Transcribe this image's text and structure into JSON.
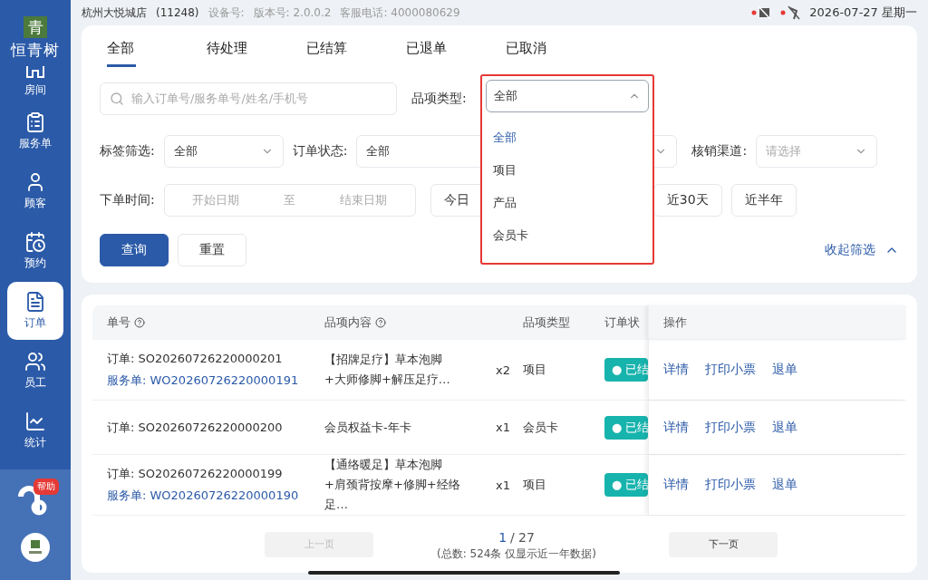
{
  "status_bar": {
    "store": "杭州大悦城店",
    "store_code": "(11248)",
    "device": "设备号:",
    "version": "版本号: 2.0.0.2",
    "hotline": "客服电话: 4000080629",
    "printer_offline": true,
    "scanner_offline": true,
    "datetime": "2026-07-27 星期一"
  },
  "sidebar": {
    "logo_mark": "青",
    "brand": "恒青树",
    "items": [
      {
        "label": "房间",
        "selected": false
      },
      {
        "label": "服务单",
        "selected": false
      },
      {
        "label": "顾客",
        "selected": false
      },
      {
        "label": "预约",
        "selected": false
      },
      {
        "label": "订单",
        "selected": true
      },
      {
        "label": "员工",
        "selected": false
      },
      {
        "label": "统计",
        "selected": false
      }
    ],
    "help_badge": "帮助"
  },
  "tabs": [
    {
      "label": "全部",
      "selected": true
    },
    {
      "label": "待处理",
      "selected": false
    },
    {
      "label": "已结算",
      "selected": false
    },
    {
      "label": "已退单",
      "selected": false
    },
    {
      "label": "已取消",
      "selected": false
    }
  ],
  "filters": {
    "search": {
      "placeholder": "输入订单号/服务单号/姓名/手机号"
    },
    "item_type": {
      "label": "品项类型:",
      "value": "全部",
      "expanded": true,
      "options": [
        {
          "label": "全部",
          "selected": true
        },
        {
          "label": "项目",
          "selected": false
        },
        {
          "label": "产品",
          "selected": false
        },
        {
          "label": "会员卡",
          "selected": false
        }
      ]
    },
    "tag": {
      "label": "标签筛选:",
      "value": "全部"
    },
    "order_status": {
      "label": "订单状态:",
      "value": "全部"
    },
    "channel": {
      "label": "核销渠道:",
      "placeholder": "请选择"
    },
    "order_time": {
      "label": "下单时间:",
      "start_placeholder": "开始日期",
      "separator": "至",
      "end_placeholder": "结束日期"
    },
    "quick_ranges": [
      "今日",
      "近30天",
      "近半年"
    ],
    "query": "查询",
    "reset": "重置",
    "collapse": "收起筛选"
  },
  "table": {
    "columns": [
      "单号",
      "品项内容",
      "品项类型",
      "订单状",
      "操作"
    ],
    "rows": [
      {
        "order": "订单: SO20260726220000201",
        "service": "服务单: WO20260726220000191",
        "content": "【招牌足疗】草本泡脚+大师修脚+解压足疗…",
        "qty": "x2",
        "type": "项目",
        "status": "● 已结",
        "actions": [
          "详情",
          "打印小票",
          "退单"
        ]
      },
      {
        "order": "订单: SO20260726220000200",
        "content": "会员权益卡-年卡",
        "qty": "x1",
        "type": "会员卡",
        "status": "● 已结",
        "actions": [
          "详情",
          "打印小票",
          "退单"
        ]
      },
      {
        "order": "订单: SO20260726220000199",
        "service": "服务单: WO20260726220000190",
        "content": "【通络暖足】草本泡脚+肩颈背按摩+修脚+经络足…",
        "qty": "x1",
        "type": "项目",
        "status": "● 已结",
        "actions": [
          "详情",
          "打印小票",
          "退单"
        ]
      }
    ]
  },
  "pagination": {
    "prev": "上一页",
    "prev_disabled": true,
    "current": "1",
    "total_pages": "/ 27",
    "summary": "(总数: 524条 仅显示近一年数据)",
    "next": "下一页"
  }
}
